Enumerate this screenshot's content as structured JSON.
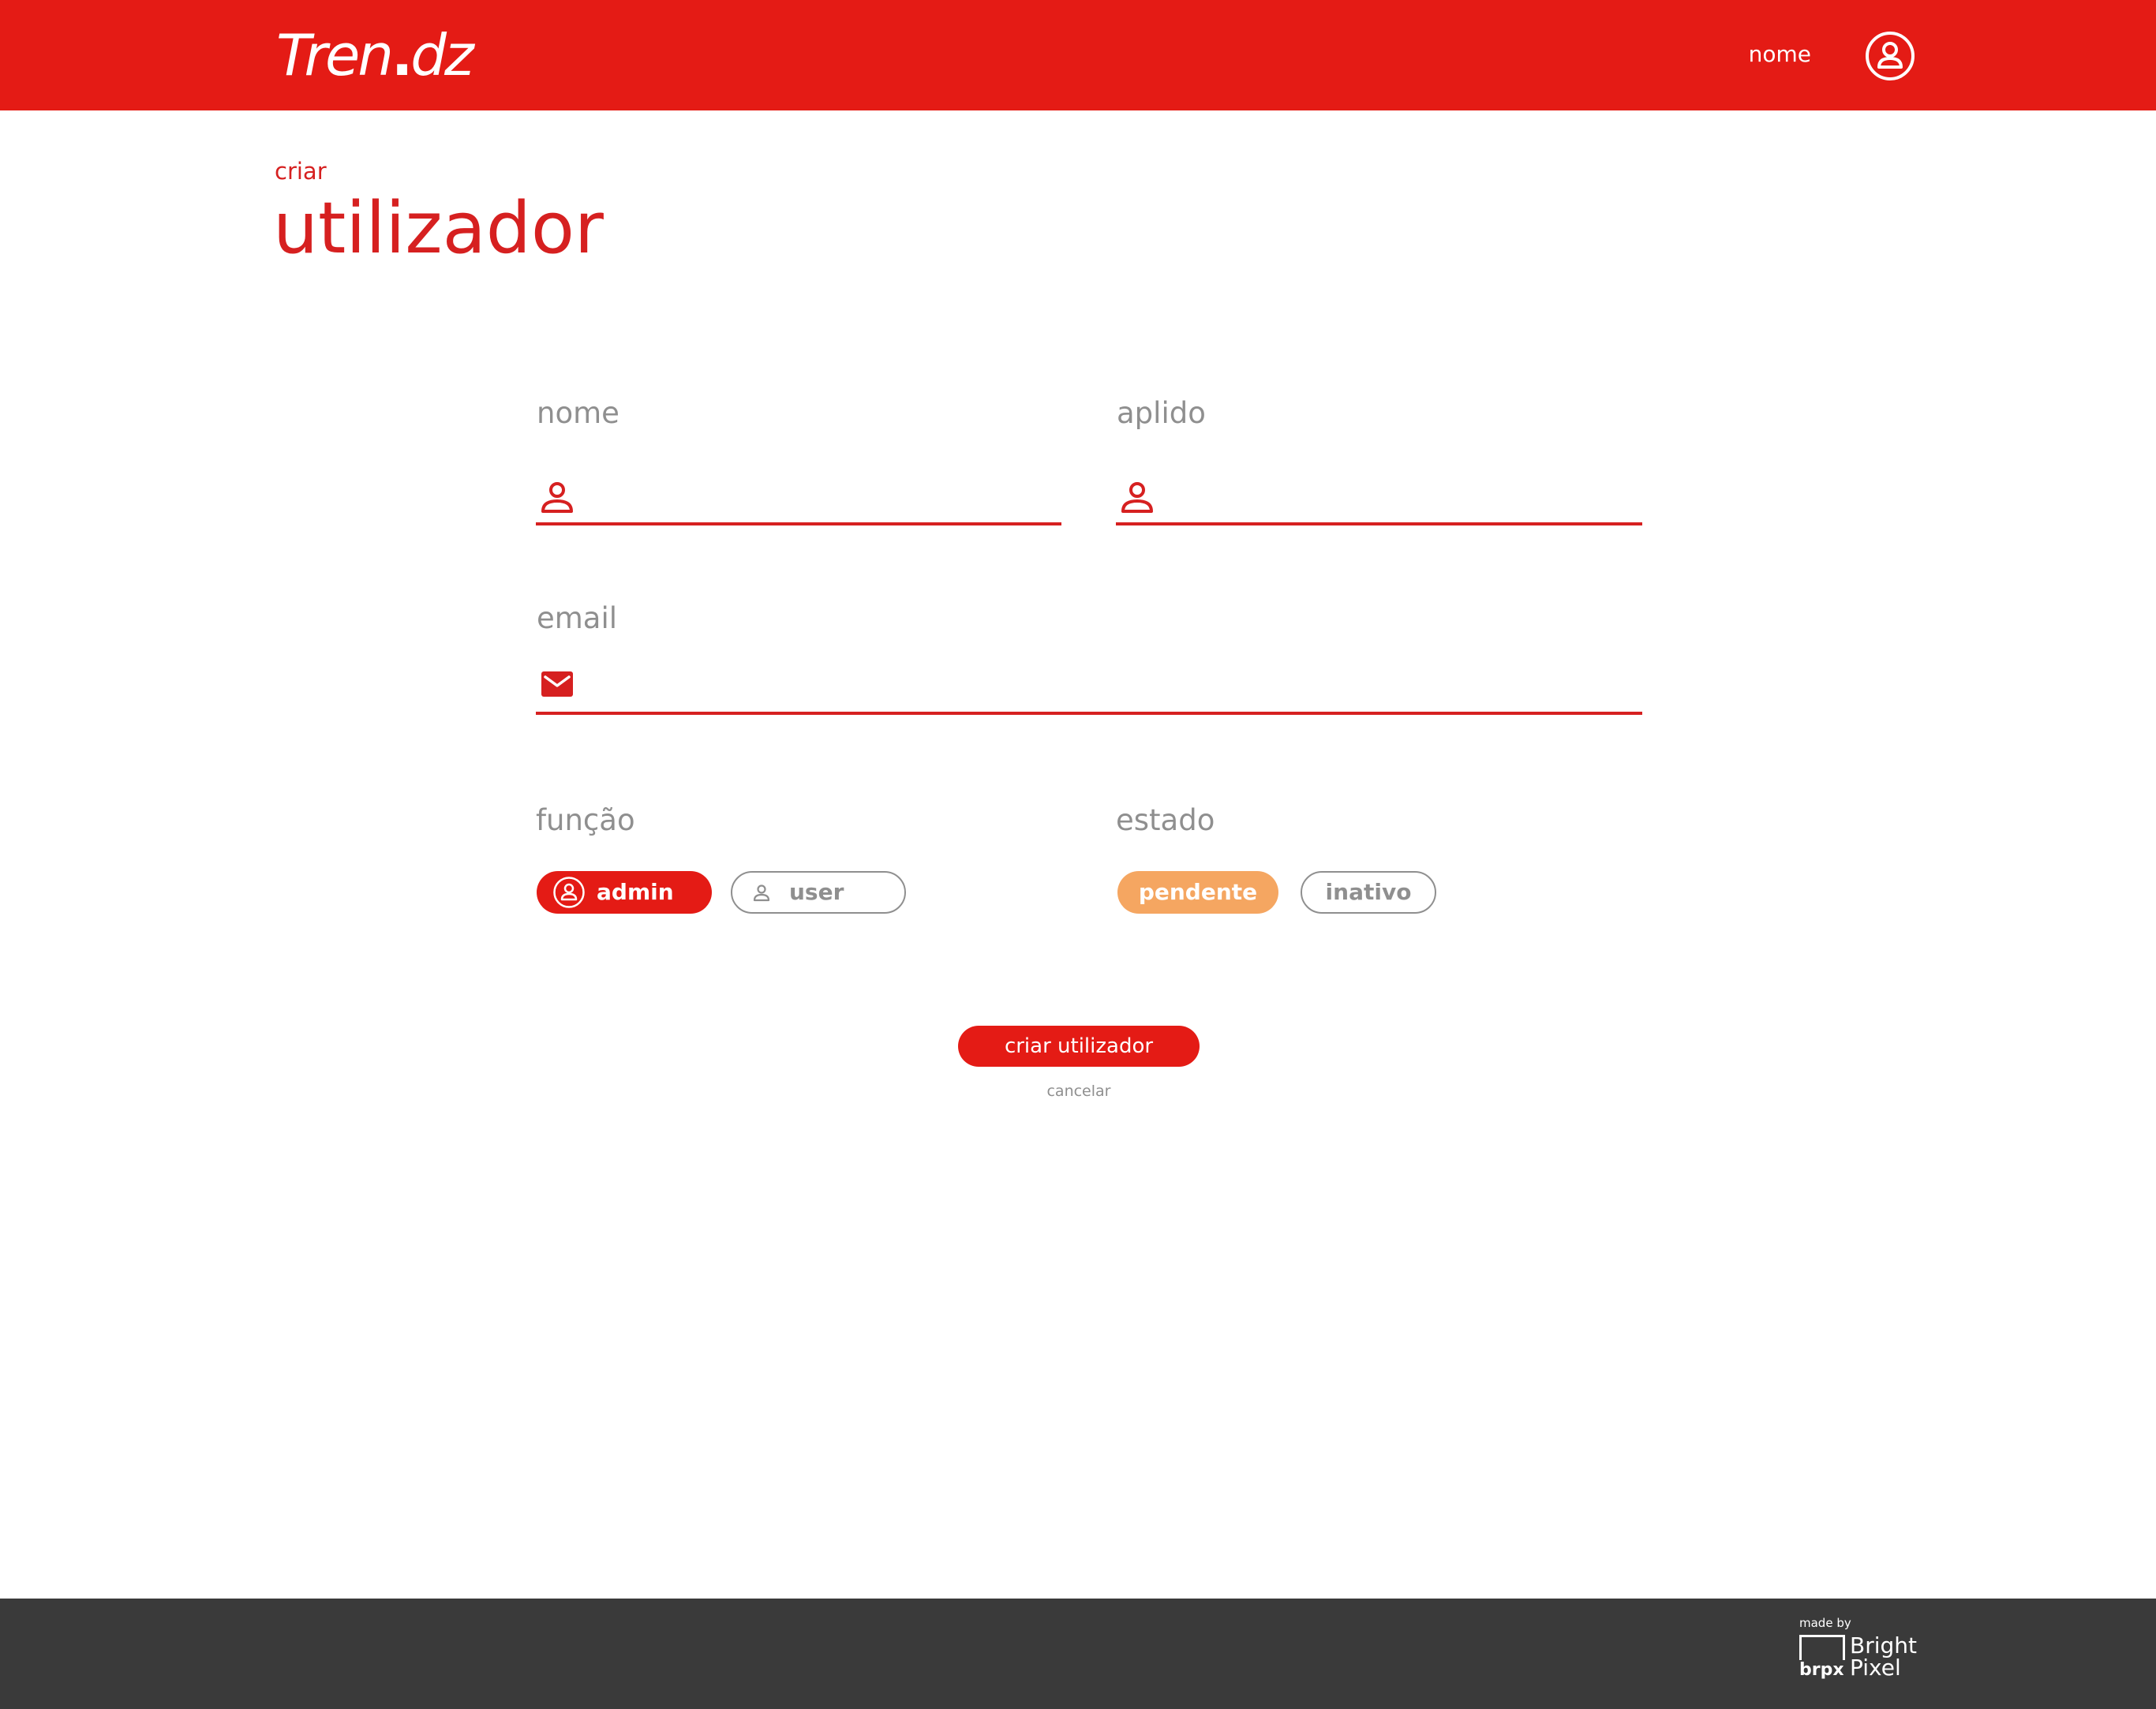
{
  "header": {
    "logo_text": "Tren",
    "logo_dot": ".",
    "logo_suffix": "dz",
    "user_name": "nome",
    "user_icon": "user-circle-icon"
  },
  "page": {
    "subtitle": "criar",
    "title": "utilizador"
  },
  "form": {
    "first_name": {
      "label": "nome",
      "value": "",
      "icon": "user-icon"
    },
    "last_name": {
      "label": "aplido",
      "value": "",
      "icon": "user-icon"
    },
    "email": {
      "label": "email",
      "value": "",
      "icon": "envelope-icon"
    },
    "role": {
      "label": "função",
      "options": [
        {
          "label": "admin",
          "selected": true,
          "icon": "user-circle-icon"
        },
        {
          "label": "user",
          "selected": false,
          "icon": "user-icon"
        }
      ]
    },
    "status": {
      "label": "estado",
      "options": [
        {
          "label": "pendente",
          "selected": true
        },
        {
          "label": "inativo",
          "selected": false
        }
      ]
    },
    "submit_label": "criar utilizador",
    "cancel_label": "cancelar"
  },
  "footer": {
    "made_by": "made by",
    "brand_short": "brpx",
    "brand_line1": "Bright",
    "brand_line2": "Pixel"
  },
  "colors": {
    "primary": "#E41B15",
    "title_red": "#D62020",
    "pending": "#F5A661",
    "muted": "#8F8F8F",
    "footer_bg": "#3A3A3A"
  }
}
